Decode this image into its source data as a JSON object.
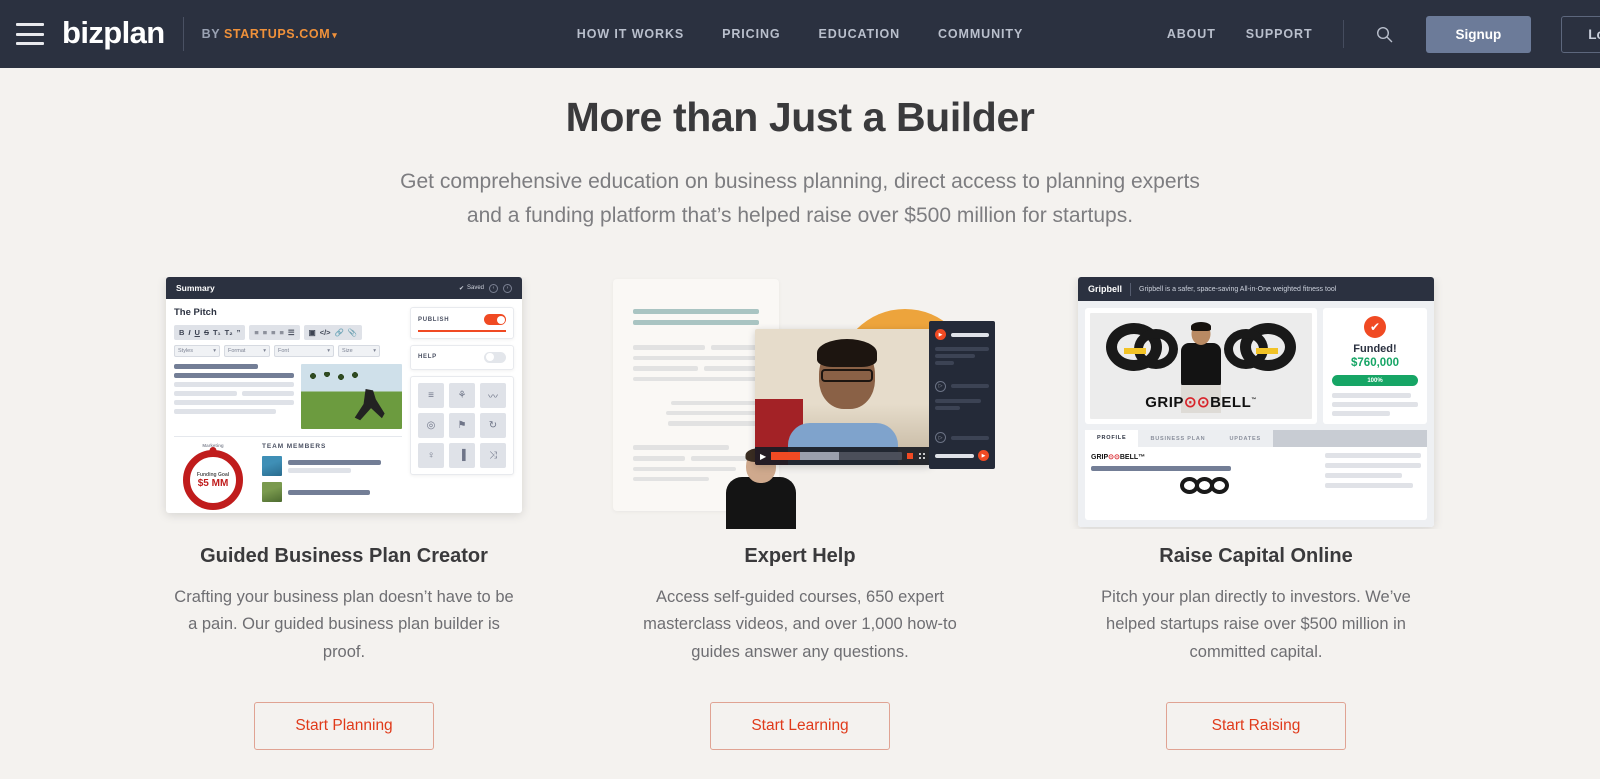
{
  "navbar": {
    "logo": "bizplan",
    "byline_prefix": "BY",
    "byline_brand": "STARTUPS.COM",
    "byline_caret": "▾",
    "links": [
      {
        "label": "HOW IT WORKS"
      },
      {
        "label": "PRICING"
      },
      {
        "label": "EDUCATION"
      },
      {
        "label": "COMMUNITY"
      }
    ],
    "right_links": [
      {
        "label": "ABOUT"
      },
      {
        "label": "SUPPORT"
      }
    ],
    "search_icon": "search-icon",
    "signup_label": "Signup",
    "login_label": "Login",
    "bg_color": "#2b3140",
    "accent_color": "#f0913a"
  },
  "hero": {
    "title": "More than Just a Builder",
    "subtitle_line1": "Get comprehensive education on business planning, direct access to planning experts",
    "subtitle_line2": "and a funding platform that’s helped raise over $500 million for startups."
  },
  "cards": [
    {
      "title": "Guided Business Plan Creator",
      "description": "Crafting your business plan doesn’t have to be a pain. Our guided business plan builder is proof.",
      "cta": "Start Planning"
    },
    {
      "title": "Expert Help",
      "description": "Access self-guided courses, 650 expert masterclass videos, and over 1,000 how-to guides answer any questions.",
      "cta": "Start Learning"
    },
    {
      "title": "Raise Capital Online",
      "description": "Pitch your plan directly to investors. We’ve helped startups raise over $500 million in committed capital.",
      "cta": "Start Raising"
    }
  ],
  "mockup_builder": {
    "titlebar": "Summary",
    "saved_label": "Saved",
    "saved_check": "✔",
    "nav_prev": "‹",
    "nav_next": "›",
    "section_title": "The Pitch",
    "toolbar_group1": [
      "B",
      "I",
      "U",
      "S",
      "T₁",
      "T₂",
      "”"
    ],
    "toolbar_group2": [
      "≡",
      "≡",
      "≡",
      "≡",
      "☰"
    ],
    "toolbar_group3": [
      "▣",
      "</>",
      "🔗",
      "📎"
    ],
    "selects": [
      "Styles",
      "Format",
      "Font",
      "Size"
    ],
    "select_caret": "▾",
    "team_heading": "TEAM MEMBERS",
    "donut_label": "Marketing",
    "donut_goal_label": "Funding Goal",
    "donut_amount": "$5 MM",
    "publish_label": "PUBLISH",
    "publish_on": true,
    "help_label": "HELP",
    "help_on": false,
    "tiles": [
      "≡",
      "⚘",
      "〰",
      "◎",
      "⚑",
      "↻",
      "♀",
      "▐",
      "⤨"
    ]
  },
  "mockup_expert": {
    "playlist_icon_active": "▶",
    "playlist_icon_plain": "▷",
    "video_play": "▶"
  },
  "mockup_raise": {
    "brand": "Gripbell",
    "tagline": "Gripbell is a safer, space-saving All-in-One weighted fitness tool",
    "check_mark": "✔",
    "funded_label": "Funded!",
    "funded_amount": "$760,000",
    "progress_label": "100%",
    "progress_pct": 100,
    "tabs": [
      "PROFILE",
      "BUSINESS PLAN",
      "UPDATES"
    ],
    "active_tab": "PROFILE",
    "wordmark_pre": "GRIP",
    "wordmark_mid": "⊙⊙",
    "wordmark_post": "BELL",
    "wordmark_tm": "™"
  },
  "colors": {
    "page_bg": "#f4f2ef",
    "nav_bg": "#2b3140",
    "orange": "#f04a23",
    "green": "#16a565",
    "amber": "#eda43c",
    "cta_text": "#e03a1a",
    "heading": "#3a3a3c",
    "body_text": "#6e6e72"
  }
}
